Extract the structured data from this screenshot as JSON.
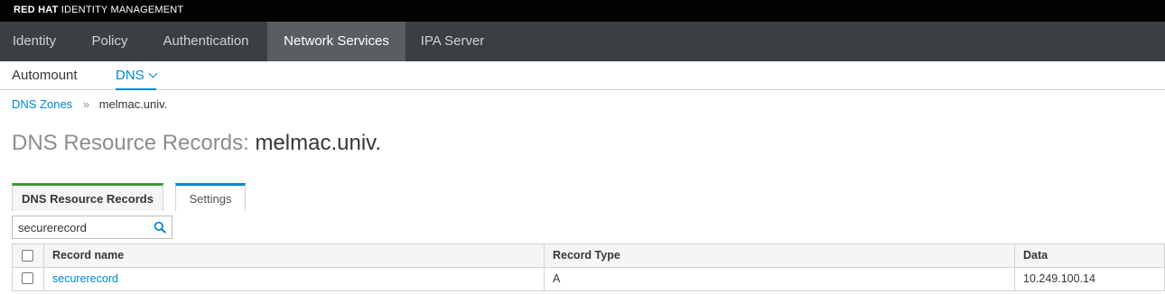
{
  "brand": {
    "bold": "RED HAT",
    "rest": "IDENTITY MANAGEMENT"
  },
  "nav": {
    "items": [
      {
        "label": "Identity"
      },
      {
        "label": "Policy"
      },
      {
        "label": "Authentication"
      },
      {
        "label": "Network Services",
        "active": true
      },
      {
        "label": "IPA Server"
      }
    ]
  },
  "subnav": {
    "items": [
      {
        "label": "Automount"
      },
      {
        "label": "DNS",
        "active": true
      }
    ]
  },
  "breadcrumb": {
    "parent": "DNS Zones",
    "separator": "»",
    "current": "melmac.univ."
  },
  "page": {
    "title_prefix": "DNS Resource Records:",
    "zone": "melmac.univ."
  },
  "tabs": [
    {
      "label": "DNS Resource Records",
      "active": true
    },
    {
      "label": "Settings"
    }
  ],
  "search": {
    "value": "securerecord",
    "icon": "search-icon"
  },
  "table": {
    "columns": [
      "Record name",
      "Record Type",
      "Data"
    ],
    "rows": [
      {
        "name": "securerecord",
        "type": "A",
        "data": "10.249.100.14"
      }
    ]
  },
  "colors": {
    "brand_bar": "#030303",
    "nav_bar": "#3c3f42",
    "nav_active": "#5b5e61",
    "link": "#0088ce",
    "tab_active_top": "#3f9c35",
    "tab_settings_top": "#0088ce"
  }
}
